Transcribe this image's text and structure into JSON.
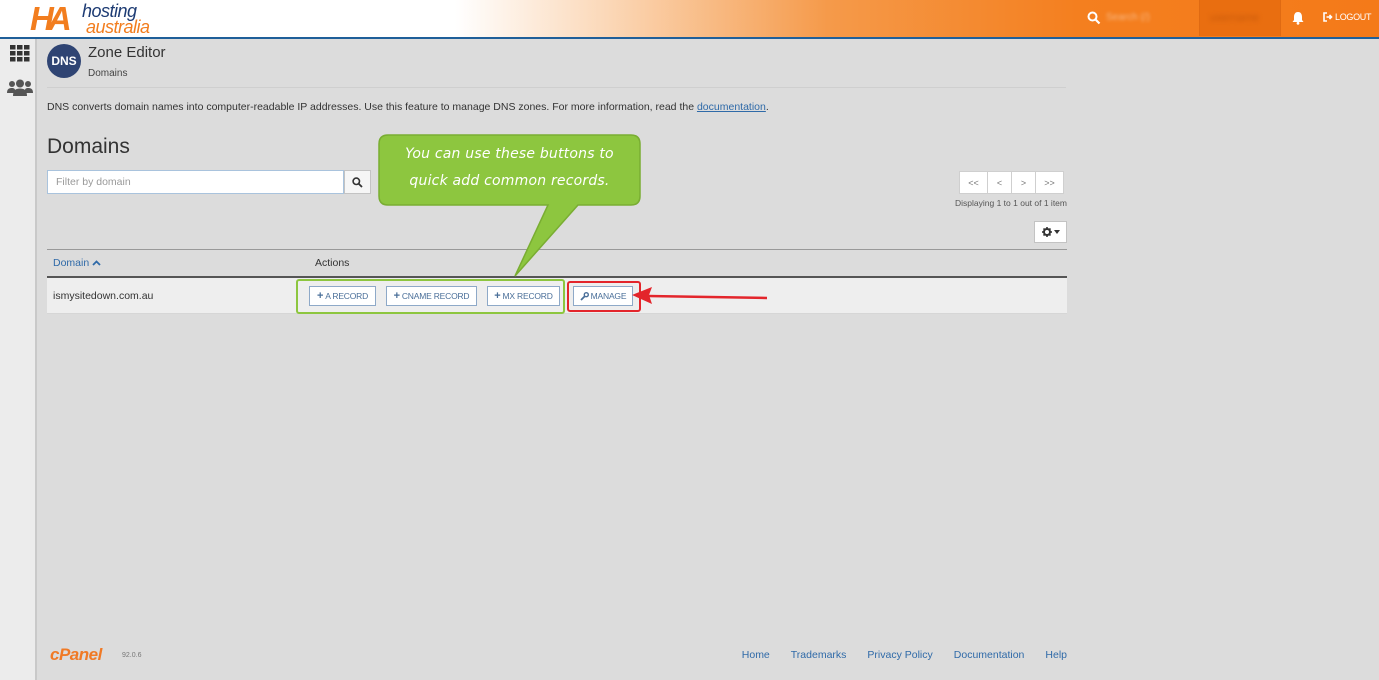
{
  "topbar": {
    "brand": {
      "mark": "HA",
      "word1": "hosting",
      "word2": "australia"
    },
    "search_placeholder": "Search (/)",
    "user_name": "username",
    "logout_label": "LOGOUT"
  },
  "header": {
    "icon_text": "DNS",
    "title": "Zone Editor",
    "breadcrumb": "Domains"
  },
  "description": {
    "text": "DNS converts domain names into computer-readable IP addresses. Use this feature to manage DNS zones. For more information, read the ",
    "link": "documentation",
    "suffix": "."
  },
  "section_title": "Domains",
  "filter": {
    "placeholder": "Filter by domain"
  },
  "pagination": {
    "first": "<<",
    "prev": "<",
    "next": ">",
    "last": ">>",
    "displaying": "Displaying 1 to 1 out of 1 item"
  },
  "table": {
    "columns": [
      "Domain",
      "Actions"
    ],
    "rows": [
      {
        "domain": "ismysitedown.com.au",
        "actions": [
          "A RECORD",
          "CNAME RECORD",
          "MX RECORD",
          "MANAGE"
        ]
      }
    ]
  },
  "callout": {
    "line1": "You can use these buttons to",
    "line2": "quick add common records."
  },
  "footer": {
    "logo": "cPanel",
    "version": "92.0.6",
    "links": [
      "Home",
      "Trademarks",
      "Privacy Policy",
      "Documentation",
      "Help"
    ]
  },
  "colors": {
    "brand_orange": "#f47f1f",
    "link_blue": "#2f6aa8",
    "callout_green": "#8dc63f",
    "annotation_red": "#e3252b"
  }
}
